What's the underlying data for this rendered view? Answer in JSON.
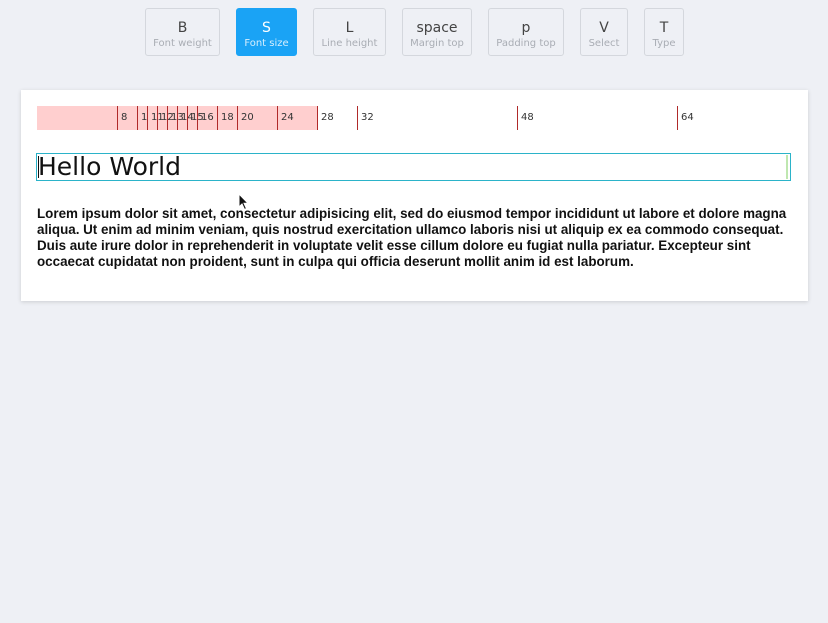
{
  "toolbar": {
    "tools": [
      {
        "key": "B",
        "label": "Font weight",
        "active": false
      },
      {
        "key": "S",
        "label": "Font size",
        "active": true
      },
      {
        "key": "L",
        "label": "Line height",
        "active": false
      },
      {
        "key": "space",
        "label": "Margin top",
        "active": false
      },
      {
        "key": "p",
        "label": "Padding top",
        "active": false
      },
      {
        "key": "V",
        "label": "Select",
        "active": false
      },
      {
        "key": "T",
        "label": "Type",
        "active": false
      }
    ]
  },
  "scale": {
    "selected_value": 28,
    "ticks": [
      {
        "value": 8,
        "label": "8"
      },
      {
        "value": 10,
        "label": "1"
      },
      {
        "value": 11,
        "label": "11"
      },
      {
        "value": 12,
        "label": "12"
      },
      {
        "value": 13,
        "label": "13"
      },
      {
        "value": 14,
        "label": "14"
      },
      {
        "value": 15,
        "label": "15"
      },
      {
        "value": 16,
        "label": "16"
      },
      {
        "value": 18,
        "label": "18"
      },
      {
        "value": 20,
        "label": "20"
      },
      {
        "value": 24,
        "label": "24"
      },
      {
        "value": 28,
        "label": "28"
      },
      {
        "value": 32,
        "label": "32"
      },
      {
        "value": 48,
        "label": "48"
      },
      {
        "value": 64,
        "label": "64"
      }
    ],
    "colors": {
      "fill": "#ffcfcf",
      "tick": "#b02a2a"
    }
  },
  "content": {
    "heading": "Hello World",
    "paragraph": "Lorem ipsum dolor sit amet, consectetur adipisicing elit, sed do eiusmod tempor incididunt ut labore et dolore magna aliqua. Ut enim ad minim veniam, quis nostrud exercitation ullamco laboris nisi ut aliquip ex ea commodo consequat. Duis aute irure dolor in reprehenderit in voluptate velit esse cillum dolore eu fugiat nulla pariatur. Excepteur sint occaecat cupidatat non proident, sunt in culpa qui officia deserunt mollit anim id est laborum."
  },
  "colors": {
    "accent": "#1aa3f5",
    "selection_outline": "#2bb3c9",
    "background": "#eef0f5"
  }
}
